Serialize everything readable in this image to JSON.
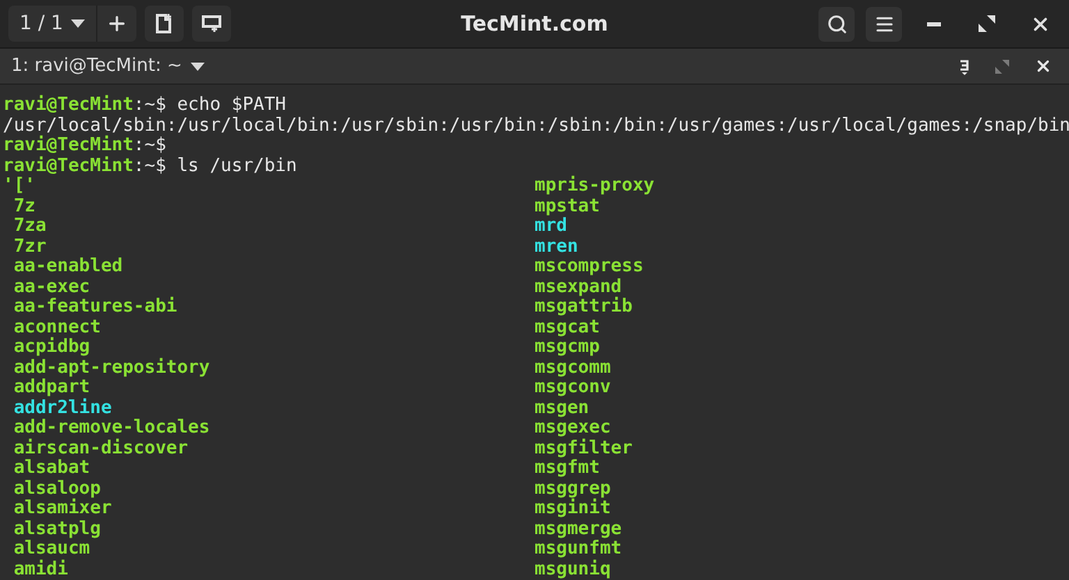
{
  "window": {
    "title": "TecMint.com",
    "session_counter": "1 / 1"
  },
  "tab": {
    "label": "1: ravi@TecMint: ~"
  },
  "terminal": {
    "lines": [
      {
        "user": "ravi@TecMint",
        "sep": ":",
        "dir": "~",
        "symbol": "$",
        "command": " echo $PATH"
      },
      {
        "output": "/usr/local/sbin:/usr/local/bin:/usr/sbin:/usr/bin:/sbin:/bin:/usr/games:/usr/local/games:/snap/bin"
      },
      {
        "user": "ravi@TecMint",
        "sep": ":",
        "dir": "~",
        "symbol": "$"
      },
      {
        "user": "ravi@TecMint",
        "sep": ":",
        "dir": "~",
        "symbol": "$",
        "command": " ls /usr/bin"
      }
    ],
    "listing": [
      [
        {
          "name": "'['",
          "kind": "exec"
        },
        {
          "name": " 7z",
          "kind": "exec"
        },
        {
          "name": " 7za",
          "kind": "exec"
        },
        {
          "name": " 7zr",
          "kind": "exec"
        },
        {
          "name": " aa-enabled",
          "kind": "exec"
        },
        {
          "name": " aa-exec",
          "kind": "exec"
        },
        {
          "name": " aa-features-abi",
          "kind": "exec"
        },
        {
          "name": " aconnect",
          "kind": "exec"
        },
        {
          "name": " acpidbg",
          "kind": "exec"
        },
        {
          "name": " add-apt-repository",
          "kind": "exec"
        },
        {
          "name": " addpart",
          "kind": "exec"
        },
        {
          "name": " addr2line",
          "kind": "link"
        },
        {
          "name": " add-remove-locales",
          "kind": "exec"
        },
        {
          "name": " airscan-discover",
          "kind": "exec"
        },
        {
          "name": " alsabat",
          "kind": "exec"
        },
        {
          "name": " alsaloop",
          "kind": "exec"
        },
        {
          "name": " alsamixer",
          "kind": "exec"
        },
        {
          "name": " alsatplg",
          "kind": "exec"
        },
        {
          "name": " alsaucm",
          "kind": "exec"
        },
        {
          "name": " amidi",
          "kind": "exec"
        }
      ],
      [
        {
          "name": "mpris-proxy",
          "kind": "exec"
        },
        {
          "name": "mpstat",
          "kind": "exec"
        },
        {
          "name": "mrd",
          "kind": "link"
        },
        {
          "name": "mren",
          "kind": "link"
        },
        {
          "name": "mscompress",
          "kind": "exec"
        },
        {
          "name": "msexpand",
          "kind": "exec"
        },
        {
          "name": "msgattrib",
          "kind": "exec"
        },
        {
          "name": "msgcat",
          "kind": "exec"
        },
        {
          "name": "msgcmp",
          "kind": "exec"
        },
        {
          "name": "msgcomm",
          "kind": "exec"
        },
        {
          "name": "msgconv",
          "kind": "exec"
        },
        {
          "name": "msgen",
          "kind": "exec"
        },
        {
          "name": "msgexec",
          "kind": "exec"
        },
        {
          "name": "msgfilter",
          "kind": "exec"
        },
        {
          "name": "msgfmt",
          "kind": "exec"
        },
        {
          "name": "msggrep",
          "kind": "exec"
        },
        {
          "name": "msginit",
          "kind": "exec"
        },
        {
          "name": "msgmerge",
          "kind": "exec"
        },
        {
          "name": "msgunfmt",
          "kind": "exec"
        },
        {
          "name": "msguniq",
          "kind": "exec"
        }
      ]
    ]
  }
}
